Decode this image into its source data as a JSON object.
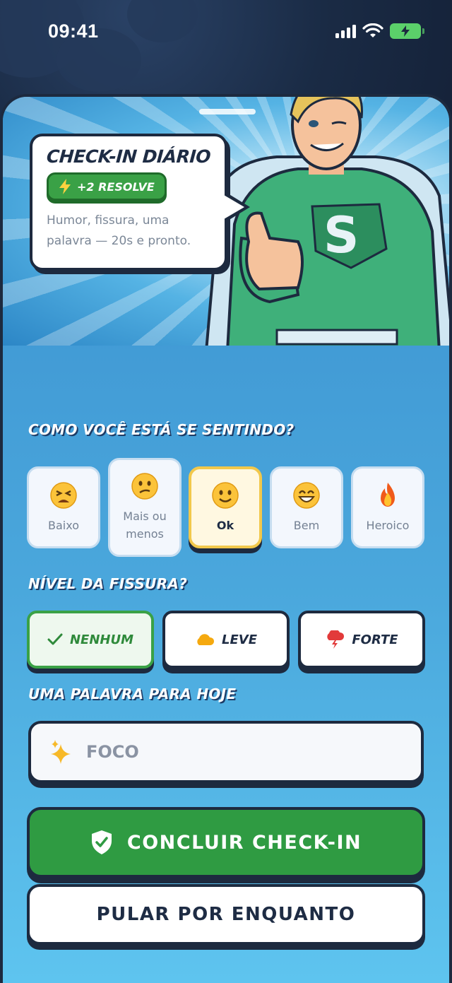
{
  "status_bar": {
    "time": "09:41"
  },
  "card": {
    "title": "CHECK-IN DIÁRIO",
    "reward": "+2 RESOLVE",
    "subtitle_line1": "Humor, fissura, uma",
    "subtitle_line2": "palavra — 20s e pronto."
  },
  "mood_section": {
    "title": "COMO VOCÊ ESTÁ SE SENTINDO?",
    "options": [
      {
        "label": "Baixo",
        "icon": "tired-face-icon",
        "selected": false
      },
      {
        "label": "Mais ou menos",
        "icon": "confused-face-icon",
        "selected": false
      },
      {
        "label": "Ok",
        "icon": "slight-smile-icon",
        "selected": true
      },
      {
        "label": "Bem",
        "icon": "grin-face-icon",
        "selected": false
      },
      {
        "label": "Heroico",
        "icon": "fire-icon",
        "selected": false
      }
    ]
  },
  "craving_section": {
    "title": "NÍVEL DA FISSURA?",
    "options": [
      {
        "label": "NENHUM",
        "icon": "check-icon",
        "selected": true
      },
      {
        "label": "LEVE",
        "icon": "cloud-icon",
        "selected": false
      },
      {
        "label": "FORTE",
        "icon": "storm-cloud-icon",
        "selected": false
      }
    ]
  },
  "word_section": {
    "title": "UMA PALAVRA PARA HOJE",
    "placeholder": "FOCO",
    "icon": "sparkles-icon"
  },
  "actions": {
    "primary": "CONCLUIR CHECK-IN",
    "secondary": "PULAR POR ENQUANTO"
  },
  "colors": {
    "accent_green": "#2f9b42",
    "selected_yellow": "#f2c84b",
    "outline": "#1d2a3f",
    "background_blue": "#4aa7dc"
  }
}
